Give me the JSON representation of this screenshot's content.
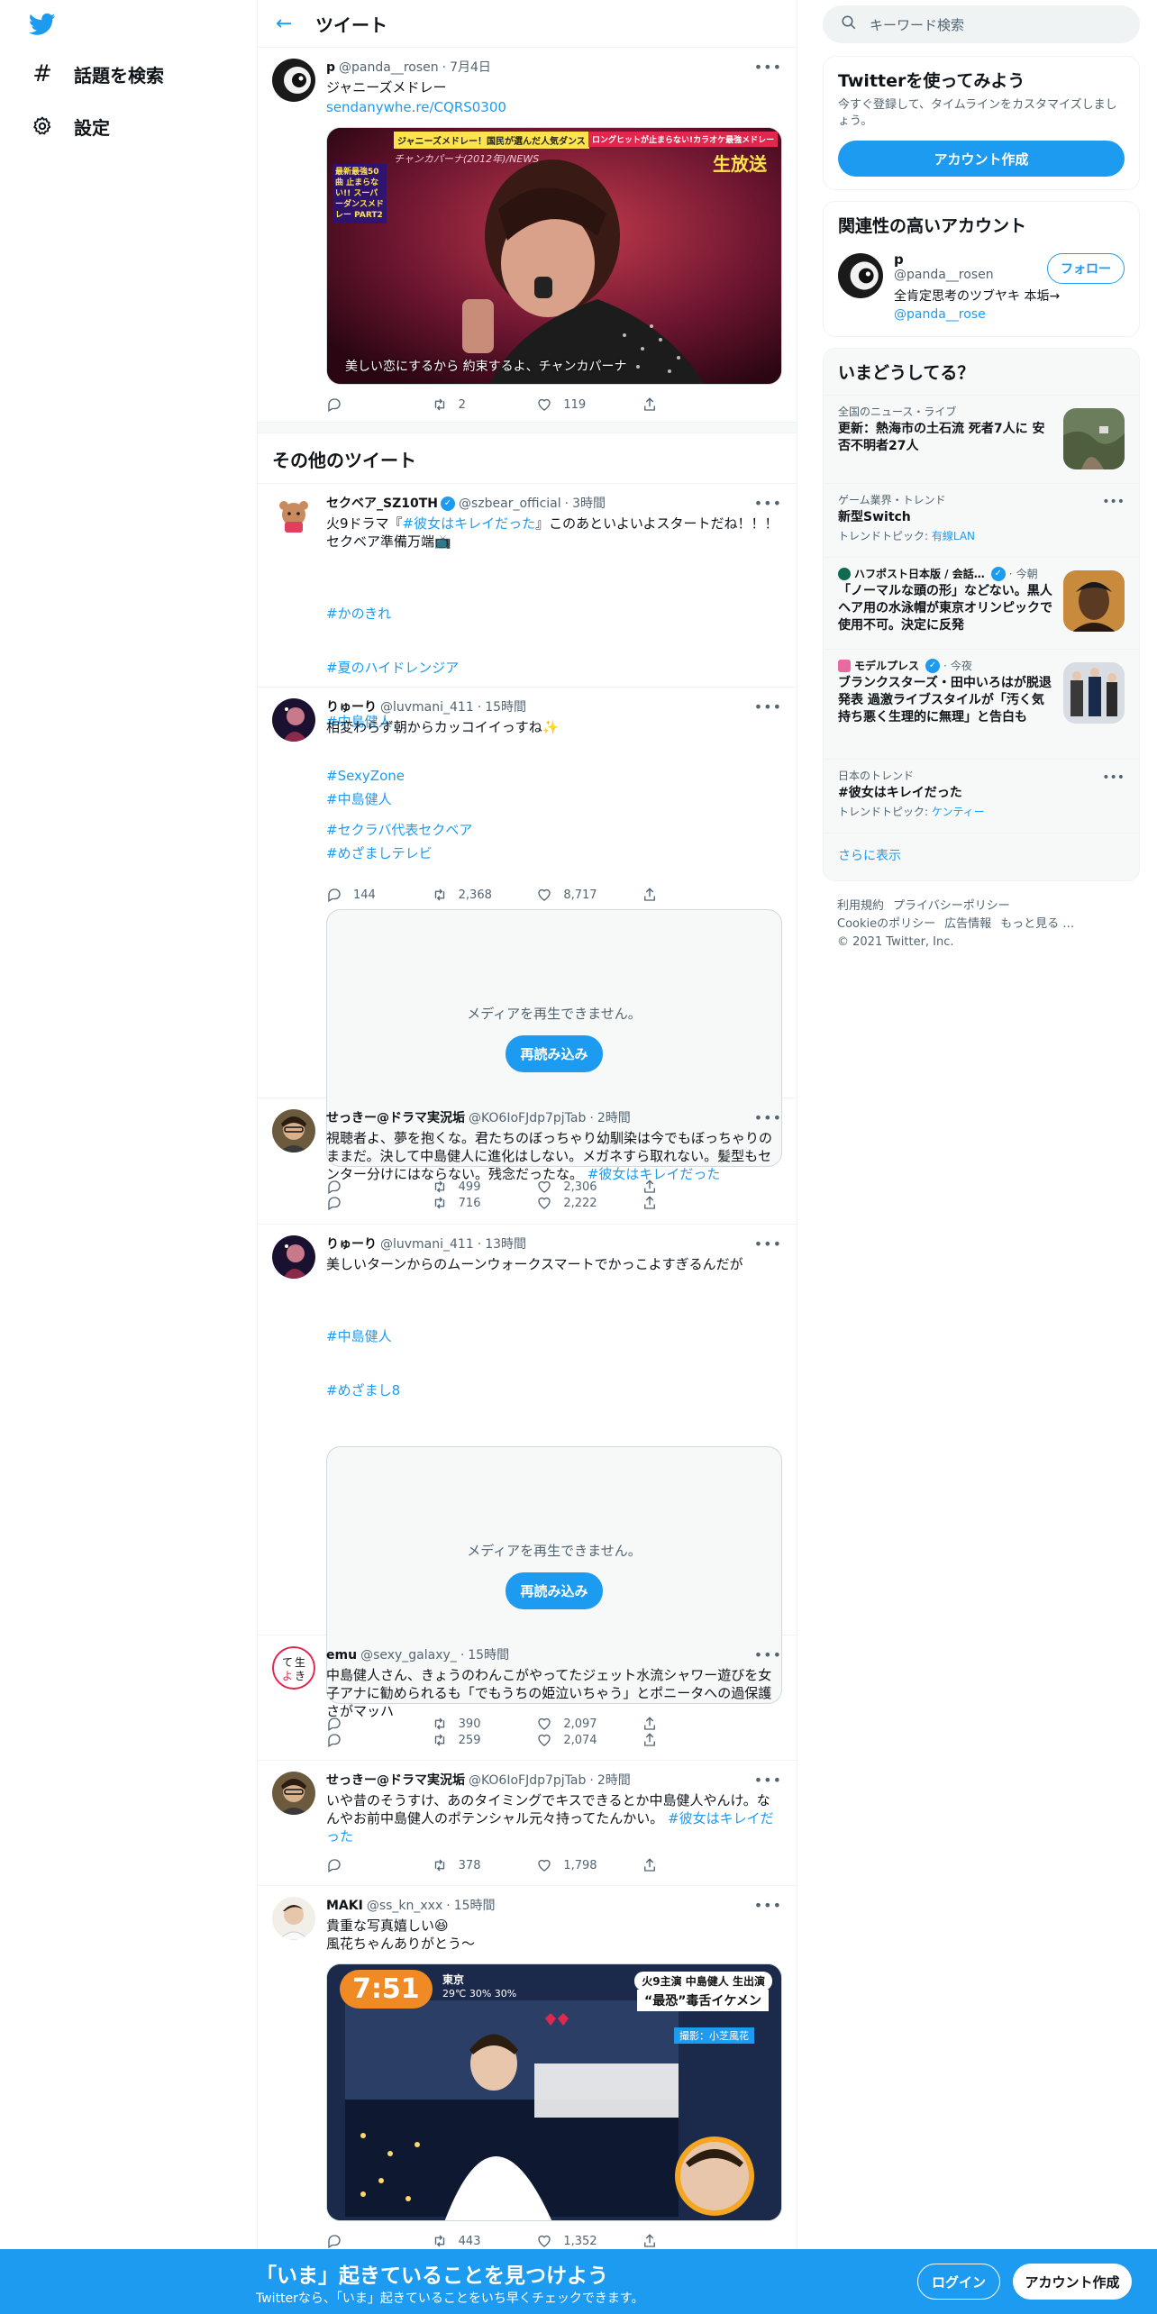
{
  "nav": {
    "explore_label": "話題を検索",
    "settings_label": "設定"
  },
  "header": {
    "title": "ツイート"
  },
  "main_tweet": {
    "name": "p",
    "handle": "@panda__rosen",
    "time": "7月4日",
    "text": "ジャニーズメドレー",
    "link": "sendanywhe.re/CQRS0300",
    "media_banner_left": "ジャニーズメドレー！国民が選んだ人気ダンス",
    "media_banner_right": "ロングヒットが止まらない!カラオケ最強メドレー",
    "media_badge": "生放送",
    "media_caption_top": "チャンカパーナ(2012年)/NEWS",
    "media_subtitle": "美しい恋にするから 約束するよ、チャンカパーナ",
    "media_side_text": "最新最強50曲 止まらない!! スーパーダンスメドレー PART2",
    "stats": {
      "reply": "",
      "retweet": "2",
      "like": "119"
    }
  },
  "other_section_title": "その他のツイート",
  "tweets": [
    {
      "name": "セクベア_SZ10TH",
      "verified": true,
      "handle": "@szbear_official",
      "time": "3時間",
      "text_prefix": "火9ドラマ『",
      "text_link": "#彼女はキレイだった",
      "text_suffix": "』このあといよいよスタートだね！！！\nセクベア準備万端📺",
      "hashtags": [
        "#かのきれ",
        "#夏のハイドレンジア",
        "#中島健人",
        "#SexyZone",
        "#セクラバ代表セクベア"
      ],
      "stats": {
        "reply": "144",
        "retweet": "2,368",
        "like": "8,717"
      }
    },
    {
      "name": "りゅーり",
      "handle": "@luvmani_411",
      "time": "15時間",
      "text": "相変わらず朝からカッコイイっすね✨",
      "hashtags": [
        "#中島健人",
        "#めざましテレビ"
      ],
      "media_msg": "メディアを再生できません。",
      "media_btn": "再読み込み",
      "stats": {
        "reply": "",
        "retweet": "499",
        "like": "2,306"
      }
    },
    {
      "name": "せっきー@ドラマ実況垢",
      "handle": "@KO6IoFJdp7pjTab",
      "time": "2時間",
      "text": "視聴者よ、夢を抱くな。君たちのぼっちゃり幼馴染は今でもぼっちゃりのままだ。決して中島健人に進化はしない。メガネすら取れない。髪型もセンター分けにはならない。残念だったな。",
      "text_link": "#彼女はキレイだった",
      "stats": {
        "reply": "",
        "retweet": "716",
        "like": "2,222"
      }
    },
    {
      "name": "りゅーり",
      "handle": "@luvmani_411",
      "time": "13時間",
      "text": "美しいターンからのムーンウォークスマートでかっこよすぎるんだが",
      "hashtags": [
        "#中島健人",
        "#めざまし8"
      ],
      "media_msg": "メディアを再生できません。",
      "media_btn": "再読み込み",
      "stats": {
        "reply": "",
        "retweet": "390",
        "like": "2,097"
      }
    },
    {
      "name": "emu",
      "handle": "@sexy_galaxy_",
      "time": "15時間",
      "text": "中島健人さん、きょうのわんこがやってたジェット水流シャワー遊びを女子アナに勧められるも「でもうちの姫泣いちゃう」とポニータへの過保護さがマッハ",
      "stats": {
        "reply": "",
        "retweet": "259",
        "like": "2,074"
      }
    },
    {
      "name": "せっきー@ドラマ実況垢",
      "handle": "@KO6IoFJdp7pjTab",
      "time": "2時間",
      "text": "いや昔のそうすけ、あのタイミングでキスできるとか中島健人やんけ。なんやお前中島健人のポテンシャル元々持ってたんかい。",
      "text_link": "#彼女はキレイだった",
      "stats": {
        "reply": "",
        "retweet": "378",
        "like": "1,798"
      }
    },
    {
      "name": "MAKI",
      "handle": "@ss_kn_xxx",
      "time": "15時間",
      "text": "貴重な写真嬉しい😆\n風花ちゃんありがとう〜",
      "photo_time": "7:51",
      "photo_place": "東京",
      "photo_temp": "29℃ 30% 30%",
      "photo_show": "火9主演 中島健人 生出演",
      "photo_catch": "“最恐”毒舌イケメン",
      "photo_credit": "撮影：小芝風花",
      "stats": {
        "reply": "",
        "retweet": "443",
        "like": "1,352"
      }
    }
  ],
  "right": {
    "search_placeholder": "キーワード検索",
    "signup_card": {
      "title": "Twitterを使ってみよう",
      "subtitle": "今すぐ登録して、タイムラインをカスタマイズしましょう。",
      "button": "アカウント作成"
    },
    "related": {
      "title": "関連性の高いアカウント",
      "name": "p",
      "handle": "@panda__rosen",
      "bio": "全肯定思考のツブヤキ 本垢→",
      "bio_link": "@panda__rose",
      "follow": "フォロー"
    },
    "trends_title": "いまどうしてる？",
    "trends": [
      {
        "meta": "全国のニュース・ライブ",
        "title": "更新：熱海市の土石流 死者7人に 安否不明者27人",
        "image": true
      },
      {
        "meta": "ゲーム業界・トレンド",
        "title": "新型Switch",
        "sub_prefix": "トレンドトピック: ",
        "sub_link": "有線LAN"
      },
      {
        "source": "ハフポスト日本版 / 会話…",
        "meta_time": "今朝",
        "title": "「ノーマルな頭の形」などない。黒人ヘア用の水泳帽が東京オリンピックで使用不可。決定に反発",
        "image": true
      },
      {
        "source": "モデルプレス",
        "meta_time": "今夜",
        "title": "ブランクスターズ・田中いろはが脱退発表 過激ライブスタイルが「汚く気持ち悪く生理的に無理」と告白も",
        "image": true
      },
      {
        "meta": "日本のトレンド",
        "title": "#彼女はキレイだった",
        "sub_prefix": "トレンドトピック: ",
        "sub_link": "ケンティー"
      }
    ],
    "show_more": "さらに表示",
    "footer": {
      "terms": "利用規約",
      "privacy": "プライバシーポリシー",
      "cookie": "Cookieのポリシー",
      "ads": "広告情報",
      "more": "もっと見る …",
      "copyright": "© 2021 Twitter, Inc."
    }
  },
  "bottom_bar": {
    "headline": "「いま」起きていることを見つけよう",
    "sub": "Twitterなら、「いま」起きていることをいち早くチェックできます。",
    "login": "ログイン",
    "signup": "アカウント作成"
  },
  "colors": {
    "accent": "#1d9bf0",
    "text": "#0f1419",
    "muted": "#536471"
  }
}
